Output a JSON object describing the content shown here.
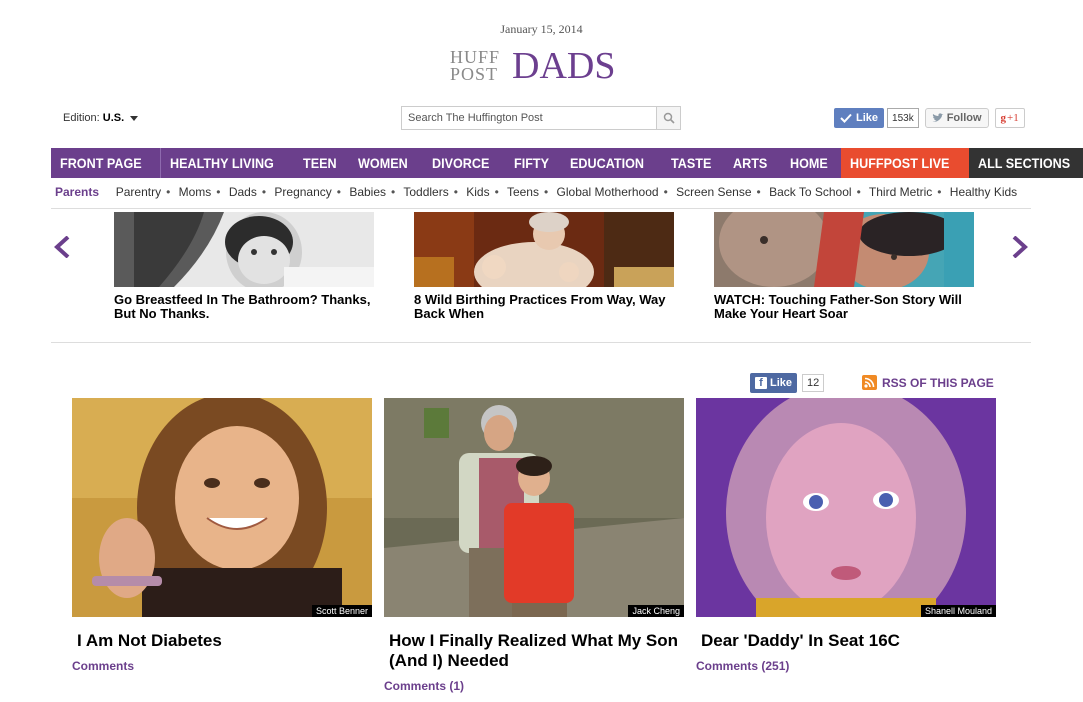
{
  "header": {
    "date": "January 15, 2014",
    "logo_huff": "HUFF",
    "logo_post": "POST",
    "logo_section": "DADS"
  },
  "edition": {
    "label": "Edition:",
    "value": "U.S."
  },
  "search": {
    "placeholder": "Search The Huffington Post"
  },
  "social": {
    "like_label": "Like",
    "like_count": "153k",
    "follow_label": "Follow",
    "gplus_label": "+1"
  },
  "nav": {
    "items": [
      "FRONT PAGE",
      "HEALTHY LIVING",
      "TEEN",
      "WOMEN",
      "DIVORCE",
      "FIFTY",
      "EDUCATION",
      "TASTE",
      "ARTS",
      "HOME",
      "HUFFPOST LIVE",
      "ALL SECTIONS"
    ]
  },
  "subnav": {
    "items": [
      "Parents",
      "Parentry",
      "Moms",
      "Dads",
      "Pregnancy",
      "Babies",
      "Toddlers",
      "Kids",
      "Teens",
      "Global Motherhood",
      "Screen Sense",
      "Back To School",
      "Third Metric",
      "Healthy Kids"
    ]
  },
  "carousel": {
    "items": [
      {
        "title": "Go Breastfeed In The Bathroom? Thanks, But No Thanks."
      },
      {
        "title": "8 Wild Birthing Practices From Way, Way Back When"
      },
      {
        "title": "WATCH: Touching Father-Son Story Will Make Your Heart Soar"
      }
    ]
  },
  "page_like": {
    "label": "Like",
    "count": "12"
  },
  "rss": {
    "label": "RSS OF THIS PAGE"
  },
  "cards": [
    {
      "credit": "Scott Benner",
      "title": "I Am Not Diabetes",
      "comments": "Comments"
    },
    {
      "credit": "Jack Cheng",
      "title": "How I Finally Realized What My Son (And I) Needed",
      "comments": "Comments (1)"
    },
    {
      "credit": "Shanell Mouland",
      "title": "Dear 'Daddy' In Seat 16C",
      "comments": "Comments (251)"
    }
  ],
  "colors": {
    "brand_purple": "#6b3f8c",
    "live_red": "#e94c2f",
    "all_sections_dark": "#333333"
  }
}
